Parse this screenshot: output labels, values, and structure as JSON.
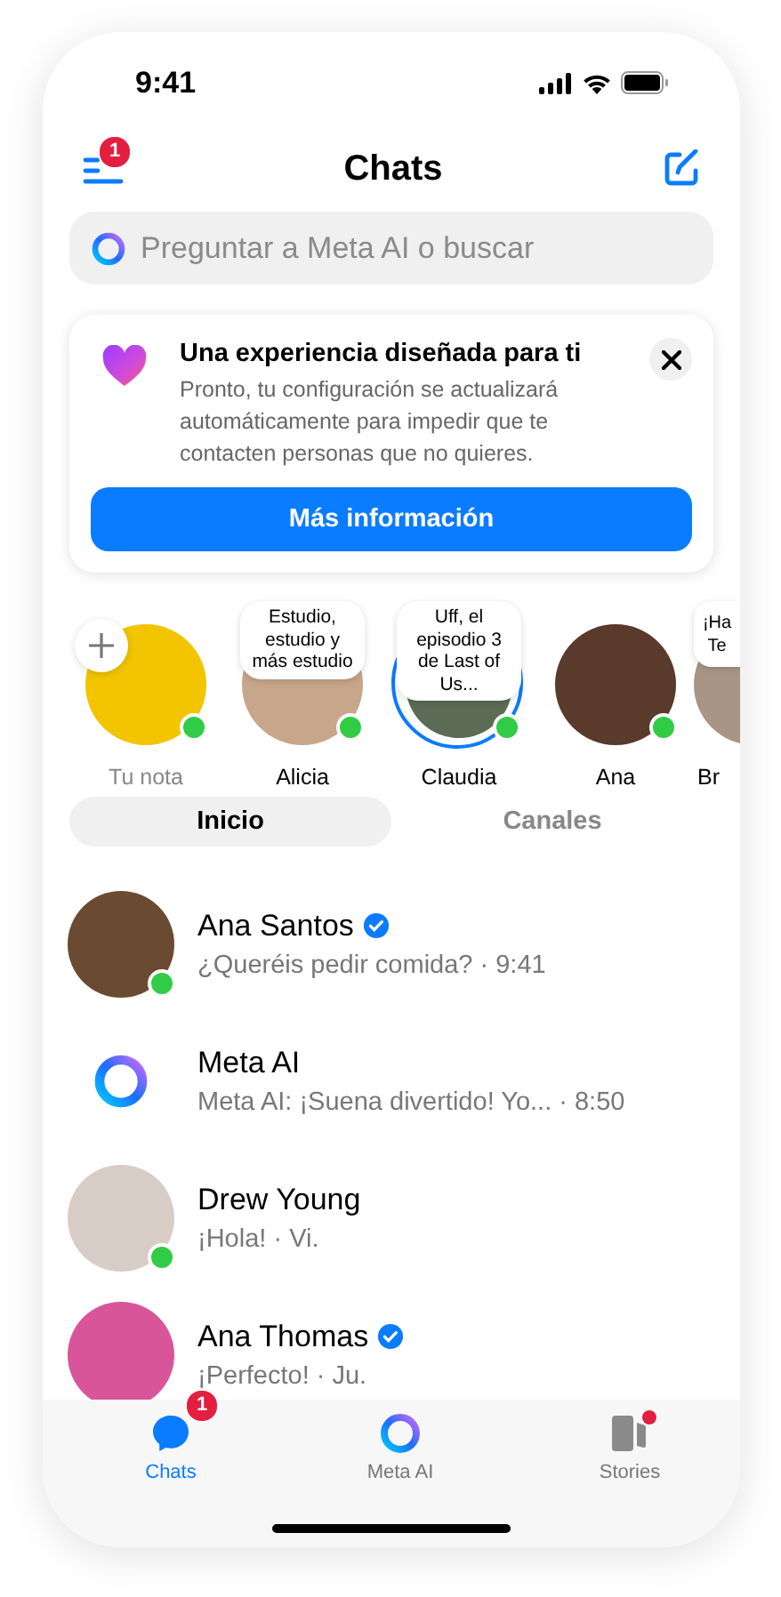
{
  "status_bar": {
    "time": "9:41"
  },
  "header": {
    "title": "Chats",
    "menu_badge": "1"
  },
  "search": {
    "placeholder": "Preguntar a Meta AI o buscar"
  },
  "notice": {
    "title": "Una experiencia diseñada para ti",
    "body": "Pronto, tu configuración se actualizará automáticamente para impedir que te contacten personas que no quieres.",
    "button": "Más información"
  },
  "notes": [
    {
      "kind": "own",
      "name": "Tu nota",
      "online": true,
      "story": false
    },
    {
      "kind": "contact",
      "name": "Alicia",
      "note": "Estudio, estudio y más estudio",
      "online": true,
      "story": false
    },
    {
      "kind": "contact",
      "name": "Claudia",
      "note": "Uff, el episodio 3 de Last of Us...",
      "online": true,
      "story": true
    },
    {
      "kind": "contact",
      "name": "Ana",
      "online": true,
      "story": false
    },
    {
      "kind": "partial",
      "name": "Br",
      "note": "¡Ha Te",
      "online": false,
      "story": false
    }
  ],
  "tabs": [
    {
      "label": "Inicio",
      "selected": true
    },
    {
      "label": "Canales",
      "selected": false
    }
  ],
  "chats": [
    {
      "kind": "person",
      "name": "Ana Santos",
      "verified": true,
      "preview": "¿Queréis pedir comida? · 9:41",
      "online": true
    },
    {
      "kind": "ai",
      "name": "Meta AI",
      "verified": false,
      "preview": "Meta AI: ¡Suena divertido! Yo... · 8:50",
      "online": false
    },
    {
      "kind": "person",
      "name": "Drew Young",
      "verified": false,
      "preview": "¡Hola! · Vi.",
      "online": true
    },
    {
      "kind": "person",
      "name": "Ana Thomas",
      "verified": true,
      "preview": "¡Perfecto! · Ju.",
      "online": false
    }
  ],
  "bottom_nav": [
    {
      "kind": "chats",
      "label": "Chats",
      "selected": true,
      "badge": "1",
      "dot": false
    },
    {
      "kind": "ai",
      "label": "Meta AI",
      "selected": false,
      "dot": false
    },
    {
      "kind": "stories",
      "label": "Stories",
      "selected": false,
      "dot": true
    }
  ]
}
